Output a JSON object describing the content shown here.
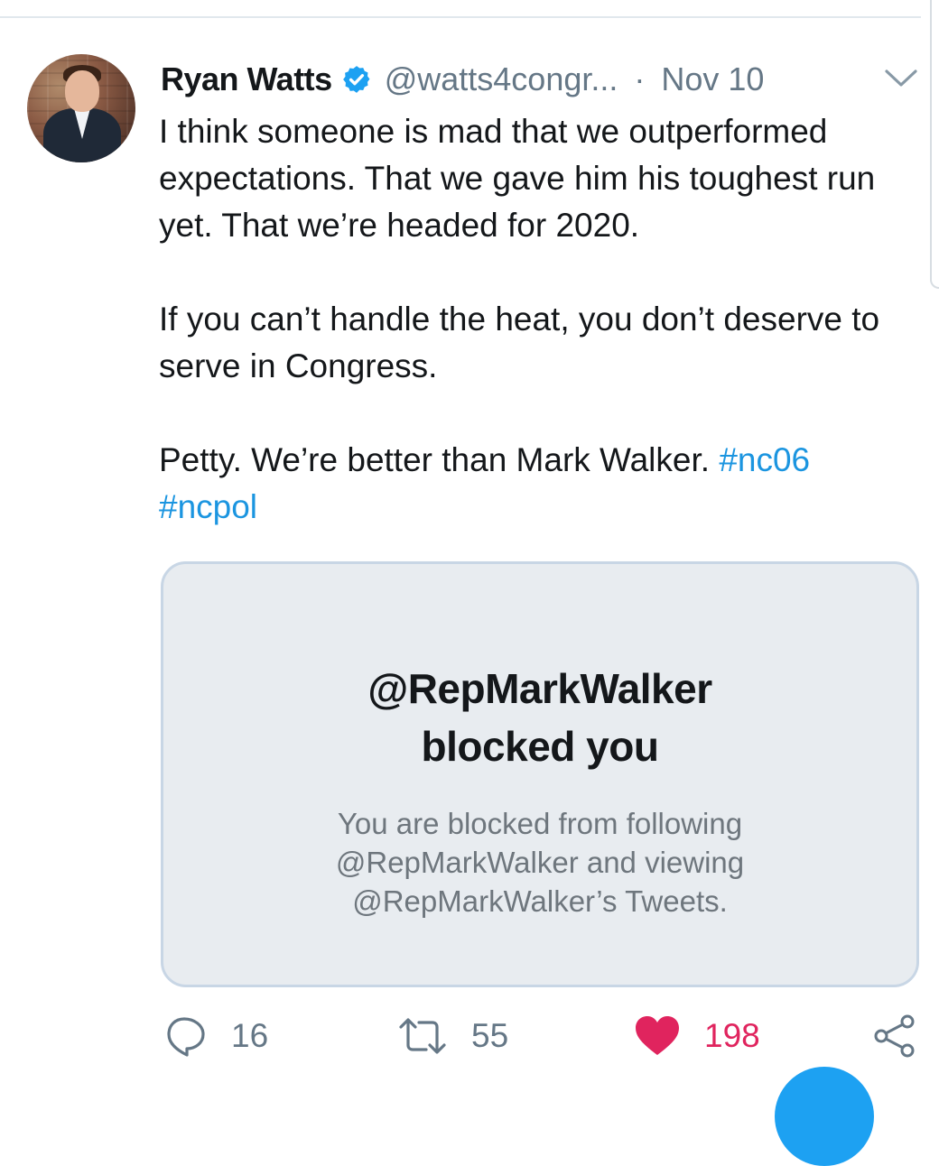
{
  "tweet": {
    "author_name": "Ryan Watts",
    "handle": "@watts4congr...",
    "separator": "·",
    "date": "Nov 10",
    "body_paragraphs": [
      "I think someone is mad that we outperformed expectations. That we gave him his toughest run yet. That we’re headed for 2020.",
      "If you can’t handle the heat, you don’t deserve to serve in Congress."
    ],
    "last_paragraph_text": "Petty. We’re better than Mark Walker. ",
    "hashtags": [
      "#nc06",
      "#ncpol"
    ]
  },
  "quote_card": {
    "title_line1": "@RepMarkWalker",
    "title_line2": "blocked you",
    "desc_line1": "You are blocked from following",
    "desc_line2": "@RepMarkWalker and viewing",
    "desc_line3": "@RepMarkWalker’s Tweets."
  },
  "actions": {
    "reply_count": "16",
    "retweet_count": "55",
    "like_count": "198"
  },
  "icons": {
    "verified": "verified-badge-icon",
    "more": "chevron-down-icon",
    "reply": "reply-bubble-icon",
    "retweet": "retweet-arrows-icon",
    "like": "heart-icon",
    "share": "share-icon"
  },
  "colors": {
    "link": "#1b95e0",
    "secondary_text": "#657786",
    "like": "#e0245e",
    "verified": "#1da1f2",
    "card_bg": "#e8ecf0"
  }
}
